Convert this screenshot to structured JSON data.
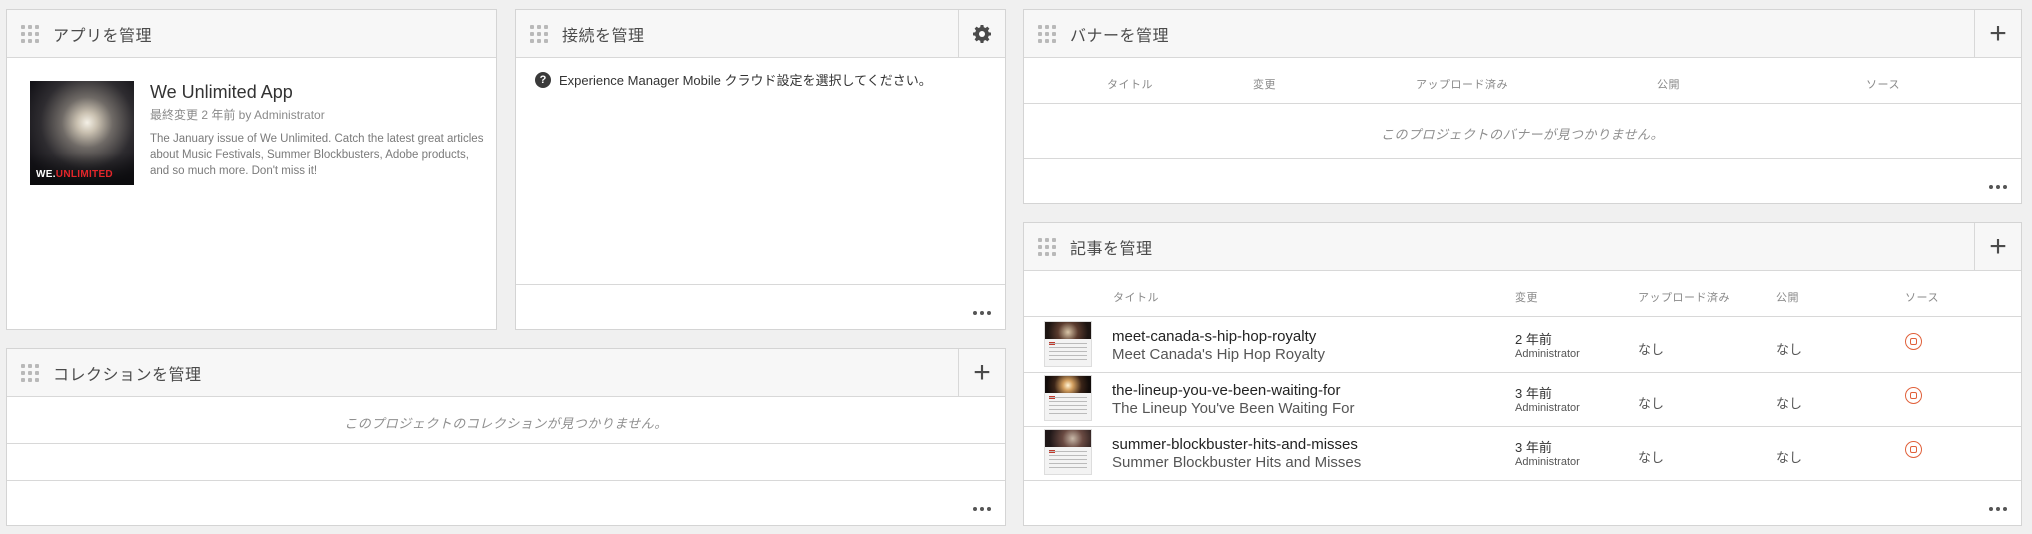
{
  "apps_card": {
    "title": "アプリを管理",
    "app_name": "We Unlimited App",
    "app_meta": "最終変更 2 年前 by Administrator",
    "app_desc": "The January issue of We Unlimited. Catch the latest great articles about Music Festivals, Summer Blockbusters, Adobe products, and so much more.  Don't miss it!",
    "thumb_brand_1": "WE.",
    "thumb_brand_2": "UNLIMITED"
  },
  "connections_card": {
    "title": "接続を管理",
    "message": "Experience Manager Mobile クラウド設定を選択してください。"
  },
  "collections_card": {
    "title": "コレクションを管理",
    "empty": "このプロジェクトのコレクションが見つかりません。"
  },
  "banners_card": {
    "title": "バナーを管理",
    "columns": [
      "タイトル",
      "変更",
      "アップロード済み",
      "公開",
      "ソース"
    ],
    "empty": "このプロジェクトのバナーが見つかりません。"
  },
  "articles_card": {
    "title": "記事を管理",
    "columns": [
      "タイトル",
      "変更",
      "アップロード済み",
      "公開",
      "ソース"
    ],
    "rows": [
      {
        "name": "meet-canada-s-hip-hop-royalty",
        "title": "Meet Canada's Hip Hop Royalty",
        "modified": "2 年前",
        "user": "Administrator",
        "uploaded": "なし",
        "published": "なし"
      },
      {
        "name": "the-lineup-you-ve-been-waiting-for",
        "title": "The Lineup You've Been Waiting For",
        "modified": "3 年前",
        "user": "Administrator",
        "uploaded": "なし",
        "published": "なし"
      },
      {
        "name": "summer-blockbuster-hits-and-misses",
        "title": "Summer Blockbuster Hits and Misses",
        "modified": "3 年前",
        "user": "Administrator",
        "uploaded": "なし",
        "published": "なし"
      }
    ]
  },
  "icons": {
    "grip": "drag-handle-icon",
    "gear": "gear-icon",
    "add": "plus-icon",
    "more": "more-icon",
    "help": "question-circle-icon",
    "source": "source-icon"
  }
}
